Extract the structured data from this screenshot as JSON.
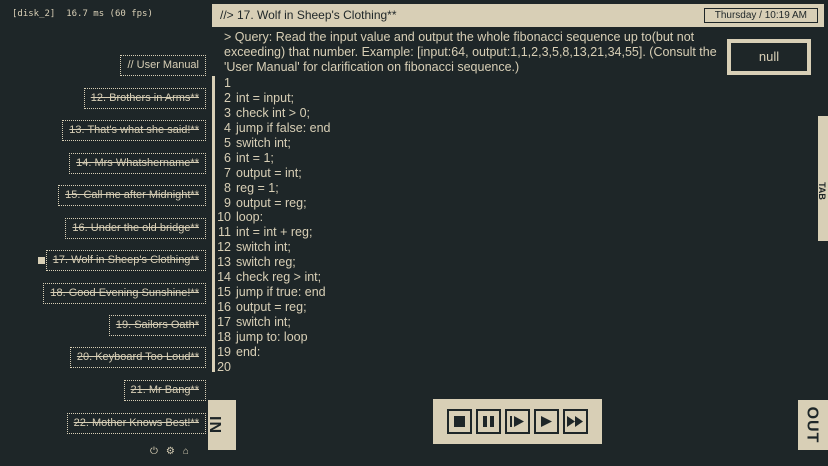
{
  "status": {
    "disk": "[disk_2]",
    "frame": "16.7 ms (60 fps)"
  },
  "levels": [
    {
      "label": "// User Manual"
    },
    {
      "label": "12. Brothers in Arms**"
    },
    {
      "label": "13. That's what she said!**"
    },
    {
      "label": "14. Mrs Whatshername**"
    },
    {
      "label": "15. Call me after Midnight**"
    },
    {
      "label": "16. Under the old bridge**"
    },
    {
      "label": "17. Wolf in Sheep's Clothing**"
    },
    {
      "label": "18. Good Evening Sunshine!**"
    },
    {
      "label": "19. Sailors Oath*"
    },
    {
      "label": "20. Keyboard Too Loud**"
    },
    {
      "label": "21. Mr Bang**"
    },
    {
      "label": "22. Mother Knows Best!**"
    }
  ],
  "header": {
    "title": "//> 17. Wolf in Sheep's Clothing**",
    "clock": "Thursday / 10:19 AM"
  },
  "query": "> Query: Read the input value and output the whole fibonacci sequence up to(but not exceeding) that number. Example: [input:64, output:1,1,2,3,5,8,13,21,34,55]. (Consult the 'User Manual' for clarification on fibonacci sequence.)",
  "output": {
    "value": "null"
  },
  "code": [
    {
      "n": "1",
      "text": ""
    },
    {
      "n": "2",
      "text": "int = input;"
    },
    {
      "n": "3",
      "text": "check int > 0;"
    },
    {
      "n": "4",
      "text": "jump if false: end"
    },
    {
      "n": "5",
      "text": "switch int;"
    },
    {
      "n": "6",
      "text": "int = 1;"
    },
    {
      "n": "7",
      "text": "output = int;"
    },
    {
      "n": "8",
      "text": "reg = 1;"
    },
    {
      "n": "9",
      "text": "output = reg;"
    },
    {
      "n": "10",
      "text": "loop:"
    },
    {
      "n": "11",
      "text": "int = int + reg;"
    },
    {
      "n": "12",
      "text": "switch int;"
    },
    {
      "n": "13",
      "text": "switch reg;"
    },
    {
      "n": "14",
      "text": "check reg > int;"
    },
    {
      "n": "15",
      "text": "jump if true: end"
    },
    {
      "n": "16",
      "text": "output = reg;"
    },
    {
      "n": "17",
      "text": "switch int;"
    },
    {
      "n": "18",
      "text": "jump to: loop"
    },
    {
      "n": "19",
      "text": "end:"
    },
    {
      "n": "20",
      "text": ""
    }
  ],
  "side_labels": {
    "tab": "TAB",
    "in": "IN",
    "out": "OUT"
  },
  "controls": [
    "stop-icon",
    "pause-icon",
    "step-icon",
    "play-icon",
    "fast-forward-icon"
  ],
  "bottom_icons": [
    "power-icon",
    "settings-icon",
    "home-icon"
  ],
  "colors": {
    "background": "#1e2628",
    "accent": "#d8cfb6"
  }
}
